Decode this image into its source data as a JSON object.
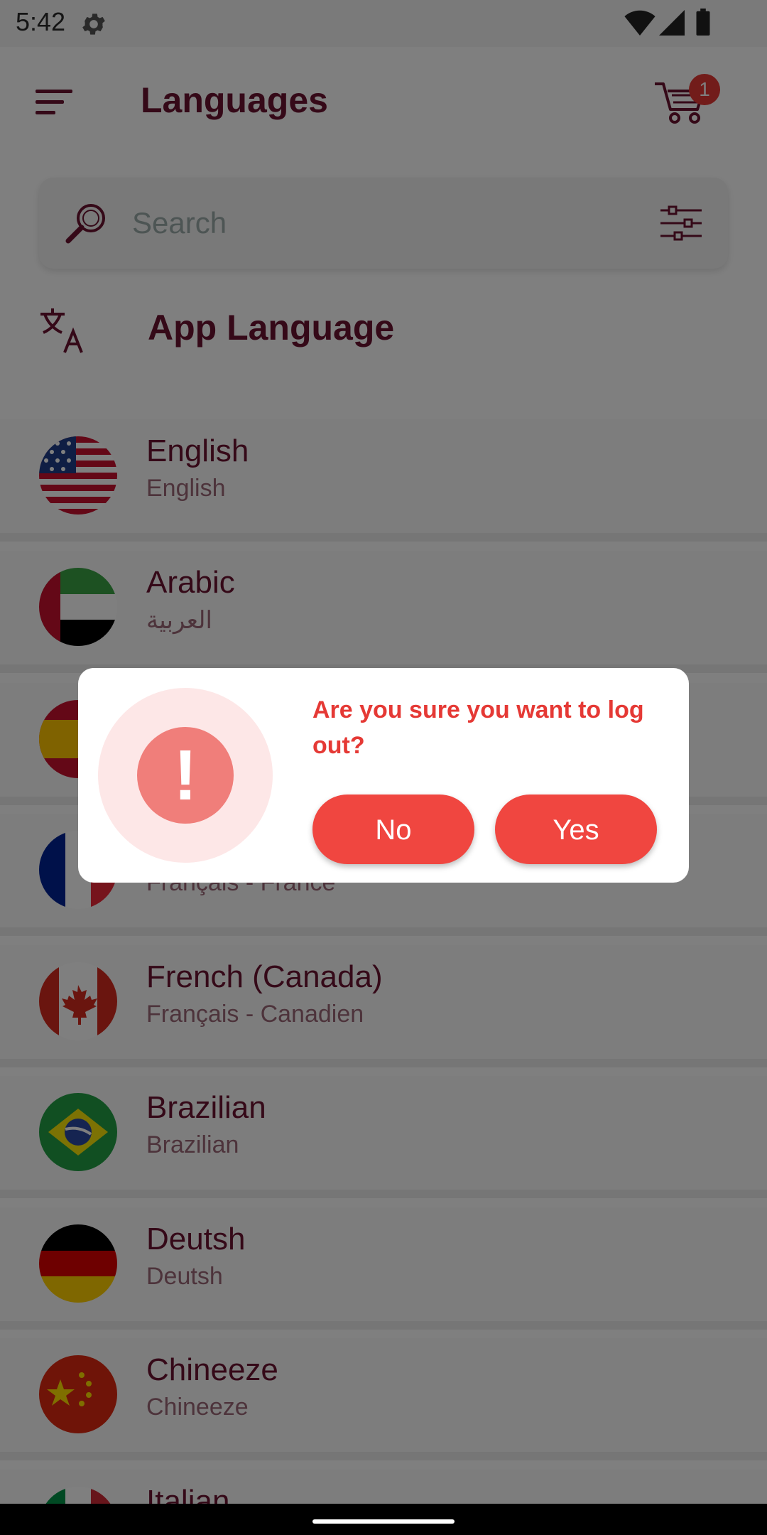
{
  "status": {
    "time": "5:42"
  },
  "header": {
    "title": "Languages",
    "cart_count": "1"
  },
  "search": {
    "placeholder": "Search"
  },
  "section": {
    "title": "App Language"
  },
  "languages": [
    {
      "name": "English",
      "native": "English",
      "flag": "us"
    },
    {
      "name": "Arabic",
      "native": "العربية",
      "flag": "ae"
    },
    {
      "name": "",
      "native": "",
      "flag": "es"
    },
    {
      "name": "",
      "native": "Français - France",
      "flag": "fr"
    },
    {
      "name": "French (Canada)",
      "native": "Français - Canadien",
      "flag": "ca"
    },
    {
      "name": "Brazilian",
      "native": "Brazilian",
      "flag": "br"
    },
    {
      "name": "Deutsh",
      "native": "Deutsh",
      "flag": "de"
    },
    {
      "name": "Chineeze",
      "native": "Chineeze",
      "flag": "cn"
    },
    {
      "name": "Italian",
      "native": "",
      "flag": "it"
    }
  ],
  "dialog": {
    "message": "Are you sure you want to log out?",
    "no_label": "No",
    "yes_label": "Yes"
  },
  "colors": {
    "brand": "#6a1230",
    "alert": "#f04640",
    "badge": "#e53935"
  }
}
